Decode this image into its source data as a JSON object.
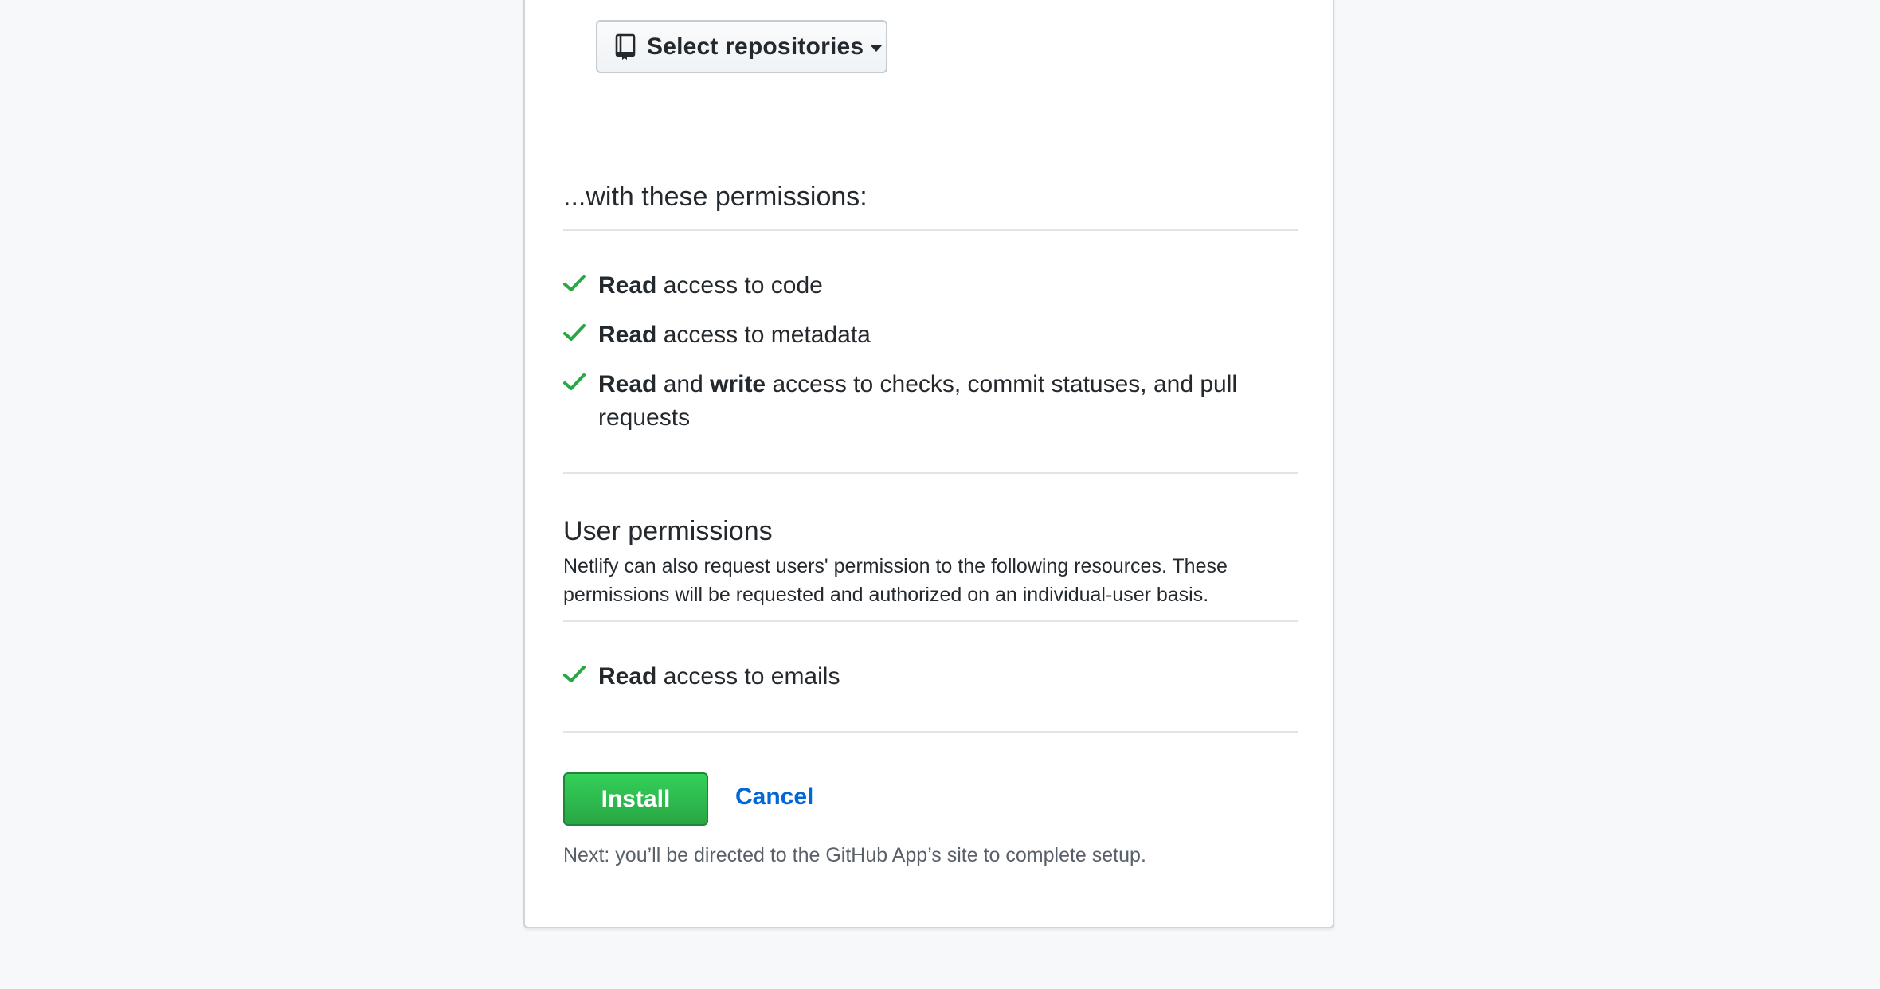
{
  "repo_selector": {
    "label": "Select repositories",
    "icon": "repo-icon"
  },
  "permissions_section": {
    "heading": "...with these permissions:",
    "items": [
      {
        "bold1": "Read",
        "mid": "",
        "bold2": "",
        "rest": " access to code",
        "icon": "check-icon"
      },
      {
        "bold1": "Read",
        "mid": "",
        "bold2": "",
        "rest": " access to metadata",
        "icon": "check-icon"
      },
      {
        "bold1": "Read",
        "mid": " and ",
        "bold2": "write",
        "rest": " access to checks, commit statuses, and pull requests",
        "icon": "check-icon"
      }
    ]
  },
  "user_permissions": {
    "heading": "User permissions",
    "description": "Netlify can also request users' permission to the following resources. These permissions will be requested and authorized on an individual-user basis.",
    "items": [
      {
        "bold1": "Read",
        "rest": " access to emails",
        "icon": "check-icon"
      }
    ]
  },
  "actions": {
    "install_label": "Install",
    "cancel_label": "Cancel",
    "next_note": "Next: you’ll be directed to the GitHub App’s site to complete setup."
  },
  "colors": {
    "check": "#28a745",
    "install_bg": "#2ea44f",
    "link": "#0366d6",
    "page_bg": "#f6f8fa"
  }
}
